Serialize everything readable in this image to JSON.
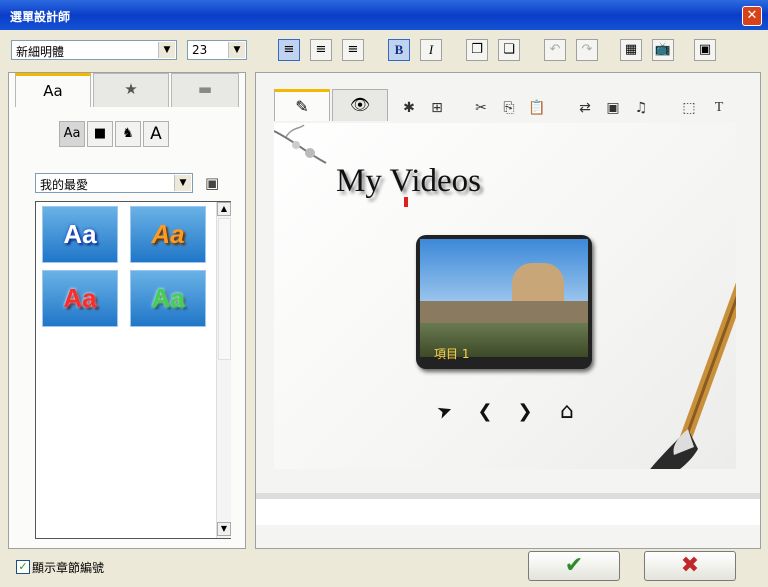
{
  "window": {
    "title": "選單設計師",
    "close_glyph": "✕"
  },
  "toolbar": {
    "font_value": "新細明體",
    "size_value": "23",
    "bold_label": "B",
    "italic_label": "I",
    "icons": [
      "align-left-icon",
      "align-center-icon",
      "align-right-icon",
      "bold-icon",
      "italic-icon",
      "bring-forward-icon",
      "send-backward-icon",
      "undo-icon",
      "redo-icon",
      "grid-icon",
      "tv-safe-icon",
      "save-icon"
    ]
  },
  "left_panel": {
    "tabs": [
      {
        "glyph": "Aa",
        "icon": "text-style-icon"
      },
      {
        "glyph": "★",
        "icon": "star-icon"
      },
      {
        "glyph": "▬",
        "icon": "background-icon"
      }
    ],
    "sub_buttons": [
      "Aa",
      "■",
      "♞",
      "A"
    ],
    "category_value": "我的最愛",
    "style_thumbs": [
      {
        "text": "Aa",
        "color": "#ffffff",
        "glow": "#1a4fd0"
      },
      {
        "text": "Aa",
        "color": "#ff9a1f",
        "glow": "#5a3000"
      },
      {
        "text": "Aa",
        "color": "#ff2a2a",
        "glow": "#ffffff"
      },
      {
        "text": "Aa",
        "color": "#3fd24a",
        "glow": "#ffffff"
      }
    ]
  },
  "right_panel": {
    "tabs": [
      {
        "icon": "edit-menu-icon",
        "glyph": "✎"
      },
      {
        "icon": "preview-eye-icon",
        "glyph": "👁"
      }
    ],
    "tool_icons": [
      {
        "name": "add-object-icon",
        "glyph": "✱"
      },
      {
        "name": "align-object-icon",
        "glyph": "⊞"
      },
      {
        "name": "cut-icon",
        "glyph": "✂"
      },
      {
        "name": "copy-icon",
        "glyph": "⎘"
      },
      {
        "name": "paste-icon",
        "glyph": "📋"
      },
      {
        "name": "change-thumbnail-icon",
        "glyph": "⇄"
      },
      {
        "name": "video-settings-icon",
        "glyph": "▣"
      },
      {
        "name": "music-icon",
        "glyph": "♫"
      },
      {
        "name": "select-area-icon",
        "glyph": "⬚"
      },
      {
        "name": "text-tool-icon",
        "glyph": "T"
      }
    ],
    "menu_title": "My Videos",
    "item_label": "項目 1",
    "nav_buttons": [
      {
        "name": "cursor-arrow-icon",
        "glyph": "➤"
      },
      {
        "name": "previous-arrow-icon",
        "glyph": "❮"
      },
      {
        "name": "next-arrow-icon",
        "glyph": "❯"
      },
      {
        "name": "home-icon",
        "glyph": "⌂"
      }
    ]
  },
  "bottom": {
    "show_chapter_label": "顯示章節編號",
    "checked": true,
    "ok_glyph": "✔",
    "cancel_glyph": "✖",
    "ok_color": "#2e8b2e",
    "cancel_color": "#c0262a"
  }
}
